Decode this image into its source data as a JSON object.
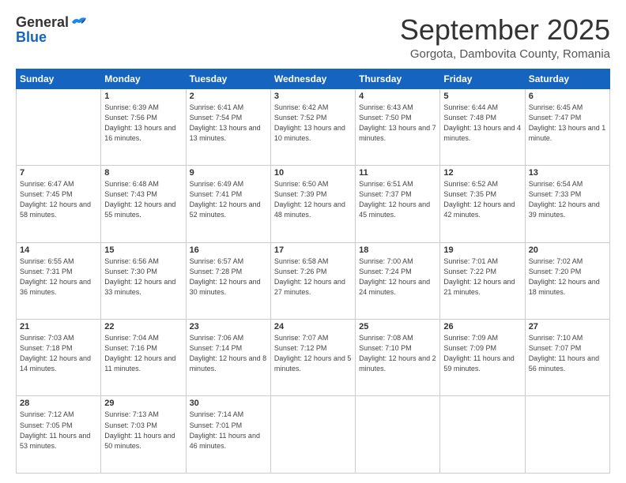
{
  "header": {
    "logo_general": "General",
    "logo_blue": "Blue",
    "month_title": "September 2025",
    "location": "Gorgota, Dambovita County, Romania"
  },
  "weekdays": [
    "Sunday",
    "Monday",
    "Tuesday",
    "Wednesday",
    "Thursday",
    "Friday",
    "Saturday"
  ],
  "weeks": [
    [
      {
        "day": "",
        "sunrise": "",
        "sunset": "",
        "daylight": ""
      },
      {
        "day": "1",
        "sunrise": "Sunrise: 6:39 AM",
        "sunset": "Sunset: 7:56 PM",
        "daylight": "Daylight: 13 hours and 16 minutes."
      },
      {
        "day": "2",
        "sunrise": "Sunrise: 6:41 AM",
        "sunset": "Sunset: 7:54 PM",
        "daylight": "Daylight: 13 hours and 13 minutes."
      },
      {
        "day": "3",
        "sunrise": "Sunrise: 6:42 AM",
        "sunset": "Sunset: 7:52 PM",
        "daylight": "Daylight: 13 hours and 10 minutes."
      },
      {
        "day": "4",
        "sunrise": "Sunrise: 6:43 AM",
        "sunset": "Sunset: 7:50 PM",
        "daylight": "Daylight: 13 hours and 7 minutes."
      },
      {
        "day": "5",
        "sunrise": "Sunrise: 6:44 AM",
        "sunset": "Sunset: 7:48 PM",
        "daylight": "Daylight: 13 hours and 4 minutes."
      },
      {
        "day": "6",
        "sunrise": "Sunrise: 6:45 AM",
        "sunset": "Sunset: 7:47 PM",
        "daylight": "Daylight: 13 hours and 1 minute."
      }
    ],
    [
      {
        "day": "7",
        "sunrise": "Sunrise: 6:47 AM",
        "sunset": "Sunset: 7:45 PM",
        "daylight": "Daylight: 12 hours and 58 minutes."
      },
      {
        "day": "8",
        "sunrise": "Sunrise: 6:48 AM",
        "sunset": "Sunset: 7:43 PM",
        "daylight": "Daylight: 12 hours and 55 minutes."
      },
      {
        "day": "9",
        "sunrise": "Sunrise: 6:49 AM",
        "sunset": "Sunset: 7:41 PM",
        "daylight": "Daylight: 12 hours and 52 minutes."
      },
      {
        "day": "10",
        "sunrise": "Sunrise: 6:50 AM",
        "sunset": "Sunset: 7:39 PM",
        "daylight": "Daylight: 12 hours and 48 minutes."
      },
      {
        "day": "11",
        "sunrise": "Sunrise: 6:51 AM",
        "sunset": "Sunset: 7:37 PM",
        "daylight": "Daylight: 12 hours and 45 minutes."
      },
      {
        "day": "12",
        "sunrise": "Sunrise: 6:52 AM",
        "sunset": "Sunset: 7:35 PM",
        "daylight": "Daylight: 12 hours and 42 minutes."
      },
      {
        "day": "13",
        "sunrise": "Sunrise: 6:54 AM",
        "sunset": "Sunset: 7:33 PM",
        "daylight": "Daylight: 12 hours and 39 minutes."
      }
    ],
    [
      {
        "day": "14",
        "sunrise": "Sunrise: 6:55 AM",
        "sunset": "Sunset: 7:31 PM",
        "daylight": "Daylight: 12 hours and 36 minutes."
      },
      {
        "day": "15",
        "sunrise": "Sunrise: 6:56 AM",
        "sunset": "Sunset: 7:30 PM",
        "daylight": "Daylight: 12 hours and 33 minutes."
      },
      {
        "day": "16",
        "sunrise": "Sunrise: 6:57 AM",
        "sunset": "Sunset: 7:28 PM",
        "daylight": "Daylight: 12 hours and 30 minutes."
      },
      {
        "day": "17",
        "sunrise": "Sunrise: 6:58 AM",
        "sunset": "Sunset: 7:26 PM",
        "daylight": "Daylight: 12 hours and 27 minutes."
      },
      {
        "day": "18",
        "sunrise": "Sunrise: 7:00 AM",
        "sunset": "Sunset: 7:24 PM",
        "daylight": "Daylight: 12 hours and 24 minutes."
      },
      {
        "day": "19",
        "sunrise": "Sunrise: 7:01 AM",
        "sunset": "Sunset: 7:22 PM",
        "daylight": "Daylight: 12 hours and 21 minutes."
      },
      {
        "day": "20",
        "sunrise": "Sunrise: 7:02 AM",
        "sunset": "Sunset: 7:20 PM",
        "daylight": "Daylight: 12 hours and 18 minutes."
      }
    ],
    [
      {
        "day": "21",
        "sunrise": "Sunrise: 7:03 AM",
        "sunset": "Sunset: 7:18 PM",
        "daylight": "Daylight: 12 hours and 14 minutes."
      },
      {
        "day": "22",
        "sunrise": "Sunrise: 7:04 AM",
        "sunset": "Sunset: 7:16 PM",
        "daylight": "Daylight: 12 hours and 11 minutes."
      },
      {
        "day": "23",
        "sunrise": "Sunrise: 7:06 AM",
        "sunset": "Sunset: 7:14 PM",
        "daylight": "Daylight: 12 hours and 8 minutes."
      },
      {
        "day": "24",
        "sunrise": "Sunrise: 7:07 AM",
        "sunset": "Sunset: 7:12 PM",
        "daylight": "Daylight: 12 hours and 5 minutes."
      },
      {
        "day": "25",
        "sunrise": "Sunrise: 7:08 AM",
        "sunset": "Sunset: 7:10 PM",
        "daylight": "Daylight: 12 hours and 2 minutes."
      },
      {
        "day": "26",
        "sunrise": "Sunrise: 7:09 AM",
        "sunset": "Sunset: 7:09 PM",
        "daylight": "Daylight: 11 hours and 59 minutes."
      },
      {
        "day": "27",
        "sunrise": "Sunrise: 7:10 AM",
        "sunset": "Sunset: 7:07 PM",
        "daylight": "Daylight: 11 hours and 56 minutes."
      }
    ],
    [
      {
        "day": "28",
        "sunrise": "Sunrise: 7:12 AM",
        "sunset": "Sunset: 7:05 PM",
        "daylight": "Daylight: 11 hours and 53 minutes."
      },
      {
        "day": "29",
        "sunrise": "Sunrise: 7:13 AM",
        "sunset": "Sunset: 7:03 PM",
        "daylight": "Daylight: 11 hours and 50 minutes."
      },
      {
        "day": "30",
        "sunrise": "Sunrise: 7:14 AM",
        "sunset": "Sunset: 7:01 PM",
        "daylight": "Daylight: 11 hours and 46 minutes."
      },
      {
        "day": "",
        "sunrise": "",
        "sunset": "",
        "daylight": ""
      },
      {
        "day": "",
        "sunrise": "",
        "sunset": "",
        "daylight": ""
      },
      {
        "day": "",
        "sunrise": "",
        "sunset": "",
        "daylight": ""
      },
      {
        "day": "",
        "sunrise": "",
        "sunset": "",
        "daylight": ""
      }
    ]
  ]
}
